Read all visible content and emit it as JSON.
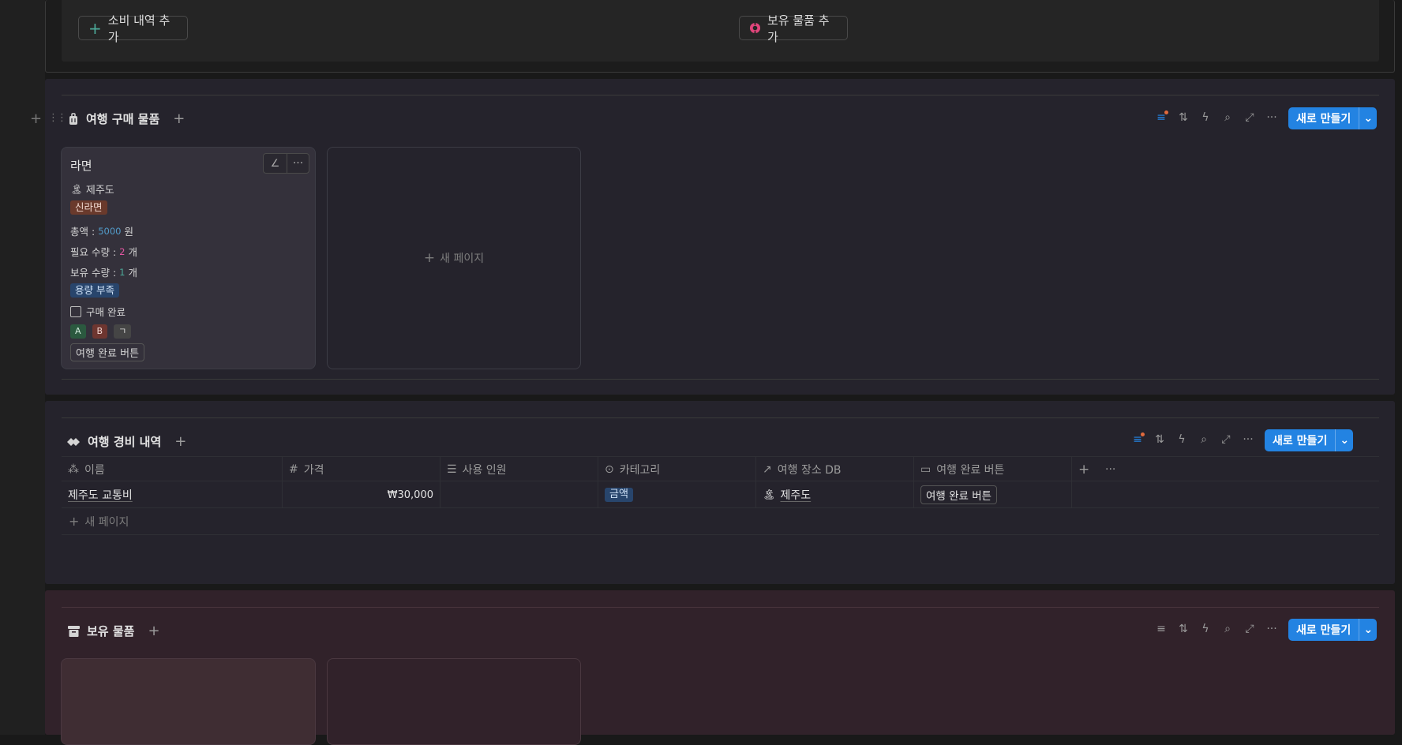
{
  "top_buttons": {
    "add_expense": "소비 내역 추가",
    "add_owned": "보유 물품 추가"
  },
  "purchase_section": {
    "title": "여행 구매 물품",
    "new_button": "새로 만들기",
    "card": {
      "title": "라면",
      "place": "제주도",
      "brand_tag": "신라면",
      "total_label": "총액 :",
      "total_value": "5000",
      "total_unit": "원",
      "need_label": "필요 수량 :",
      "need_value": "2",
      "need_unit": "개",
      "have_label": "보유 수량 :",
      "have_value": "1",
      "have_unit": "개",
      "status_tag": "용량 부족",
      "checkbox_label": "구매 완료",
      "small_tags": [
        "A",
        "B",
        "ㄱ"
      ],
      "done_button": "여행 완료 버튼"
    },
    "new_page_label": "새 페이지"
  },
  "expense_section": {
    "title": "여행 경비 내역",
    "new_button": "새로 만들기",
    "columns": [
      "이름",
      "가격",
      "사용 인원",
      "카테고리",
      "여행 장소 DB",
      "여행 완료 버튼"
    ],
    "rows": [
      {
        "name": "제주도 교통비",
        "price": "₩30,000",
        "people": "",
        "category": "금액",
        "place": "제주도",
        "button": "여행 완료 버튼"
      }
    ],
    "new_page_label": "새 페이지"
  },
  "owned_section": {
    "title": "보유 물품",
    "new_button": "새로 만들기"
  },
  "colors": {
    "accent": "#2383e2",
    "brand_tag_bg": "#6a3a2c",
    "status_tag_bg": "#28456c",
    "category_tag_bg": "#28456c",
    "tag_a_bg": "#2b593f",
    "tag_b_bg": "#6e3630",
    "tag_c_bg": "#454545"
  }
}
